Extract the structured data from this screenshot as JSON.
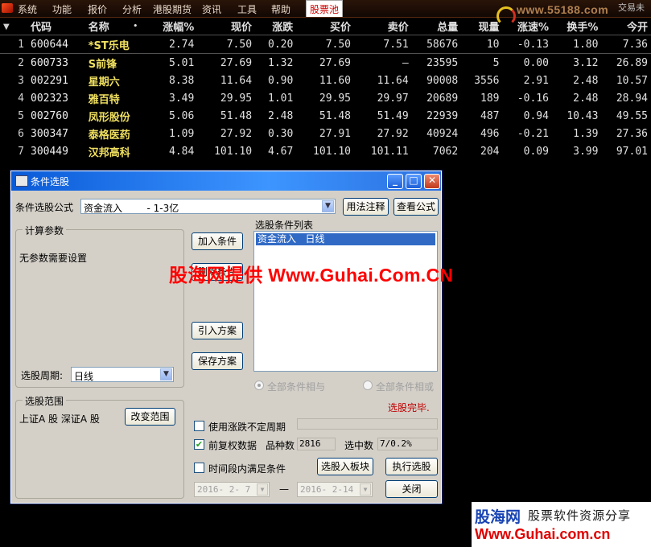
{
  "menubar": {
    "items": [
      "系统",
      "功能",
      "报价",
      "分析",
      "港股期货",
      "资讯",
      "工具",
      "帮助",
      "股票池"
    ],
    "active_index": 8,
    "brand": "www.55188.com",
    "brand_sub": "交易未"
  },
  "quote_table": {
    "headers": [
      "代码",
      "名称",
      "•",
      "涨幅%",
      "现价",
      "涨跌",
      "买价",
      "卖价",
      "总量",
      "现量",
      "涨速%",
      "换手%",
      "今开"
    ],
    "rows": [
      {
        "idx": "1",
        "code": "600644",
        "name": "*ST乐电",
        "chg_pct": "2.74",
        "price": "7.50",
        "chg": "0.20",
        "bid": "7.50",
        "ask": "7.51",
        "volume": "58676",
        "cur_vol": "10",
        "speed": "-0.13",
        "turnover": "1.80",
        "open": "7.36"
      },
      {
        "idx": "2",
        "code": "600733",
        "name": "S前锋",
        "chg_pct": "5.01",
        "price": "27.69",
        "chg": "1.32",
        "bid": "27.69",
        "ask": "—",
        "volume": "23595",
        "cur_vol": "5",
        "speed": "0.00",
        "turnover": "3.12",
        "open": "26.89"
      },
      {
        "idx": "3",
        "code": "002291",
        "name": "星期六",
        "chg_pct": "8.38",
        "price": "11.64",
        "chg": "0.90",
        "bid": "11.60",
        "ask": "11.64",
        "volume": "90008",
        "cur_vol": "3556",
        "speed": "2.91",
        "turnover": "2.48",
        "open": "10.57"
      },
      {
        "idx": "4",
        "code": "002323",
        "name": "雅百特",
        "chg_pct": "3.49",
        "price": "29.95",
        "chg": "1.01",
        "bid": "29.95",
        "ask": "29.97",
        "volume": "20689",
        "cur_vol": "189",
        "speed": "-0.16",
        "turnover": "2.48",
        "open": "28.94"
      },
      {
        "idx": "5",
        "code": "002760",
        "name": "凤形股份",
        "chg_pct": "5.06",
        "price": "51.48",
        "chg": "2.48",
        "bid": "51.48",
        "ask": "51.49",
        "volume": "22939",
        "cur_vol": "487",
        "speed": "0.94",
        "turnover": "10.43",
        "open": "49.55"
      },
      {
        "idx": "6",
        "code": "300347",
        "name": "泰格医药",
        "chg_pct": "1.09",
        "price": "27.92",
        "chg": "0.30",
        "bid": "27.91",
        "ask": "27.92",
        "volume": "40924",
        "cur_vol": "496",
        "speed": "-0.21",
        "turnover": "1.39",
        "open": "27.36"
      },
      {
        "idx": "7",
        "code": "300449",
        "name": "汉邦高科",
        "chg_pct": "4.84",
        "price": "101.10",
        "chg": "4.67",
        "bid": "101.10",
        "ask": "101.11",
        "volume": "7062",
        "cur_vol": "204",
        "speed": "0.09",
        "turnover": "3.99",
        "open": "97.01"
      }
    ]
  },
  "dialog": {
    "title": "条件选股",
    "formula_label": "条件选股公式",
    "formula_value": "资金流入        - 1-3亿",
    "usage_button": "用法注释",
    "view_formula_button": "查看公式",
    "params_group": "计算参数",
    "params_text": "无参数需要设置",
    "period_label": "选股周期:",
    "period_value": "日线",
    "add_condition_button": "加入条件",
    "delete_condition_button": "删除条件",
    "import_plan_button": "引入方案",
    "save_plan_button": "保存方案",
    "condition_list_label": "选股条件列表",
    "condition_items": [
      "资金流入   日线"
    ],
    "radio_and": "全部条件相与",
    "radio_or": "全部条件相或",
    "status_text": "选股完毕.",
    "range_group": "选股范围",
    "range_text": "上证A 股 深证A 股",
    "change_range_button": "改变范围",
    "use_uncertain_period": "使用涨跌不定周期",
    "forward_adjust": "前复权数据",
    "stock_count_label": "品种数",
    "stock_count": "2816",
    "selected_label": "选中数",
    "selected_value": "7/0.2%",
    "time_range_label": "时间段内满足条件",
    "to_block_button": "选股入板块",
    "execute_button": "执行选股",
    "date_from": "2016- 2- 7",
    "date_sep": "—",
    "date_to": "2016- 2-14",
    "close_button": "关闭"
  },
  "watermark": "股海网提供 Www.Guhai.Com.CN",
  "footer_ad": {
    "brand": "股海网",
    "slogan": "股票软件资源分享",
    "url": "Www.Guhai.com.cn"
  }
}
